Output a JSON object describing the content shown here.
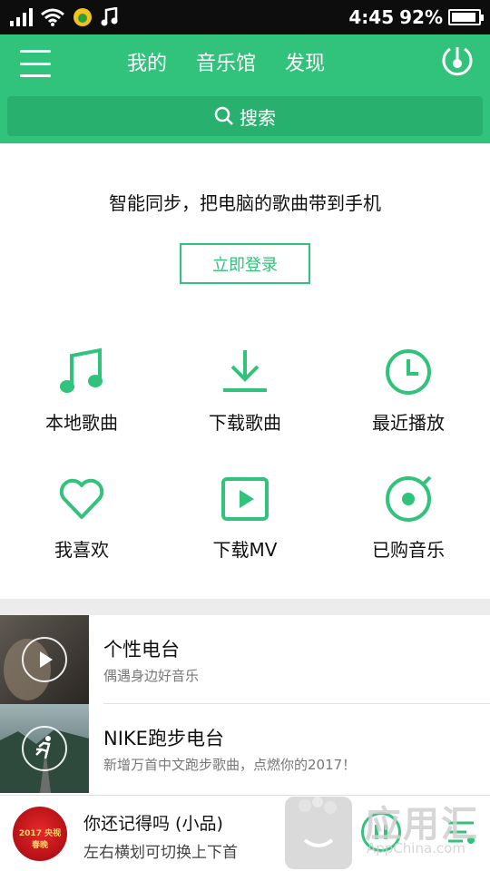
{
  "status_bar": {
    "time": "4:45",
    "battery": "92%",
    "battery_level": 0.92
  },
  "header": {
    "tabs": [
      {
        "label": "我的"
      },
      {
        "label": "音乐馆"
      },
      {
        "label": "发现"
      }
    ],
    "search_label": "搜索",
    "accent_color": "#31c27c"
  },
  "promo": {
    "text": "智能同步，把电脑的歌曲带到手机",
    "login_label": "立即登录"
  },
  "grid": [
    {
      "label": "本地歌曲",
      "icon": "music-note-icon"
    },
    {
      "label": "下载歌曲",
      "icon": "download-icon"
    },
    {
      "label": "最近播放",
      "icon": "clock-icon"
    },
    {
      "label": "我喜欢",
      "icon": "heart-icon"
    },
    {
      "label": "下载MV",
      "icon": "video-play-icon"
    },
    {
      "label": "已购音乐",
      "icon": "disc-icon"
    }
  ],
  "radio": [
    {
      "title": "个性电台",
      "subtitle": "偶遇身边好音乐"
    },
    {
      "title": "NIKE跑步电台",
      "subtitle": "新增万首中文跑步歌曲，点燃你的2017！"
    }
  ],
  "player": {
    "song": "你还记得吗 (小品)",
    "hint": "左右横划可切换上下首",
    "cover_text": "2017 央视春晚"
  },
  "watermark": {
    "name": "应用汇",
    "url": "AppChina.com"
  }
}
